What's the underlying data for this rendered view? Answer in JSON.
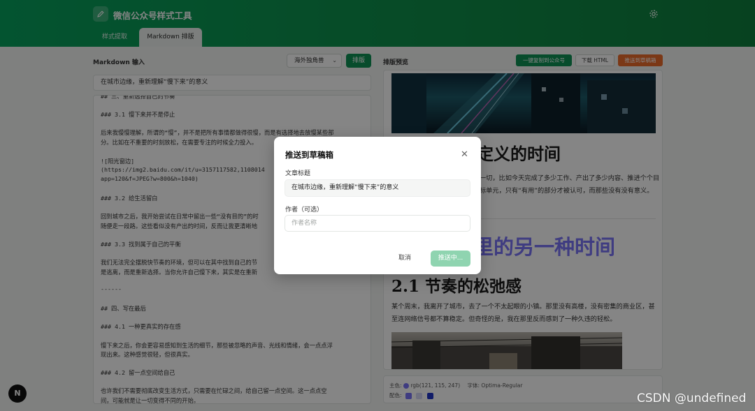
{
  "app": {
    "title": "微信公众号样式工具"
  },
  "tabs": [
    {
      "label": "样式提取",
      "active": false
    },
    {
      "label": "Markdown 排版",
      "active": true
    }
  ],
  "editor": {
    "label": "Markdown 输入",
    "theme_select": "海外独角兽",
    "format_button": "排版",
    "title_value": "在城市边缘，重新理解“慢下来”的意义",
    "lines": [
      "## 三、重新选择自己的节奏",
      "### 3.1 慢下来并不是停止",
      "后来我慢慢理解，所谓的“慢”，并不是把所有事情都做得很慢，而是有选择地去放慢某些部",
      "分。比如在不重要的时刻放松，在需要专注的时候全力投入。",
      "![阳光窗边]",
      "(https://img2.baidu.com/it/u=3157117582,1108014",
      "app=120&f=JPEG?w=800&h=1040)",
      "### 3.2 给生活留白",
      "回到城市之后，我开始尝试在日常中留出一些“没有目的”的时",
      "随便走一段路。这些看似没有产出的时间，反而让我更清晰地",
      "### 3.3 找到属于自己的平衡",
      "我们无法完全摆脱快节奏的环境，但可以在其中找到自己的节",
      "是逃离，而是重新选择。当你允许自己慢下来，其实是在重新",
      "------",
      "## 四、写在最后",
      "### 4.1 一种更真实的存在感",
      "慢下来之后，你会更容易感知到生活的细节，那些被忽略的声音、光线和情绪，会一点点浮",
      "现出来。这种感觉很轻，但很真实。",
      "### 4.2 留一点空间给自己",
      "也许我们不需要彻底改变生活方式，只需要在忙碌之间，给自己留一点空间。这一点点空",
      "间，可能就是让一切变得不同的开始。"
    ]
  },
  "preview": {
    "label": "排版预览",
    "copy_button": "一键复制到公众号",
    "download_button": "下载 HTML",
    "push_button": "推送到草稿箱",
    "h1": "定义的时间",
    "p1": "一切，比如今天完成了多少工作、产出了多少内容、推进个个目标单元，只有“有用”的部分才被认可，而那些没有没有意义。",
    "h1b": "里的另一种时间",
    "h2": "2.1 节奏的松弛感",
    "p2": "某个周末，我离开了城市，去了一个不太起眼的小镇。那里没有高楼，没有密集的商业区，甚至连网络信号都不算稳定。但奇怪的是，我在那里反而感到了一种久违的轻松。",
    "primary_color_label": "主色:",
    "primary_color_value": "rgb(121, 115, 247)",
    "font_label": "字体: Optima-Regular",
    "palette_label": "配色:",
    "palette": [
      "#7973f7",
      "#d6d9f6",
      "#1f34c8"
    ]
  },
  "modal": {
    "title": "推送到草稿箱",
    "title_label": "文章标题",
    "title_value": "在城市边缘，重新理解“慢下来”的意义",
    "author_label": "作者（可选）",
    "author_placeholder": "作者名称",
    "cancel": "取消",
    "submit": "推送中..."
  },
  "badge": "N",
  "watermark": "CSDN @undefined"
}
